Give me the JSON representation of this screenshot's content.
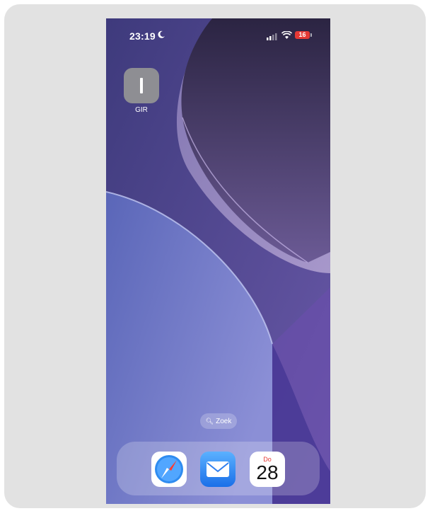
{
  "status": {
    "time": "23:19",
    "battery": "16",
    "icons": [
      "moon-icon",
      "cellular-icon",
      "wifi-icon",
      "battery-icon"
    ]
  },
  "home": {
    "apps": [
      {
        "label": "GIR",
        "icon": "gray-bar-icon"
      }
    ],
    "search": {
      "label": "Zoek",
      "icon": "search-icon"
    }
  },
  "dock": {
    "apps": [
      {
        "name": "Safari",
        "icon": "safari-compass-icon"
      },
      {
        "name": "Mail",
        "icon": "mail-envelope-icon"
      },
      {
        "name": "Calendar",
        "icon": "calendar-icon",
        "day": "Do",
        "date": "28"
      }
    ]
  },
  "colors": {
    "battery": "#e53935",
    "accent": "#6c5aa8"
  }
}
